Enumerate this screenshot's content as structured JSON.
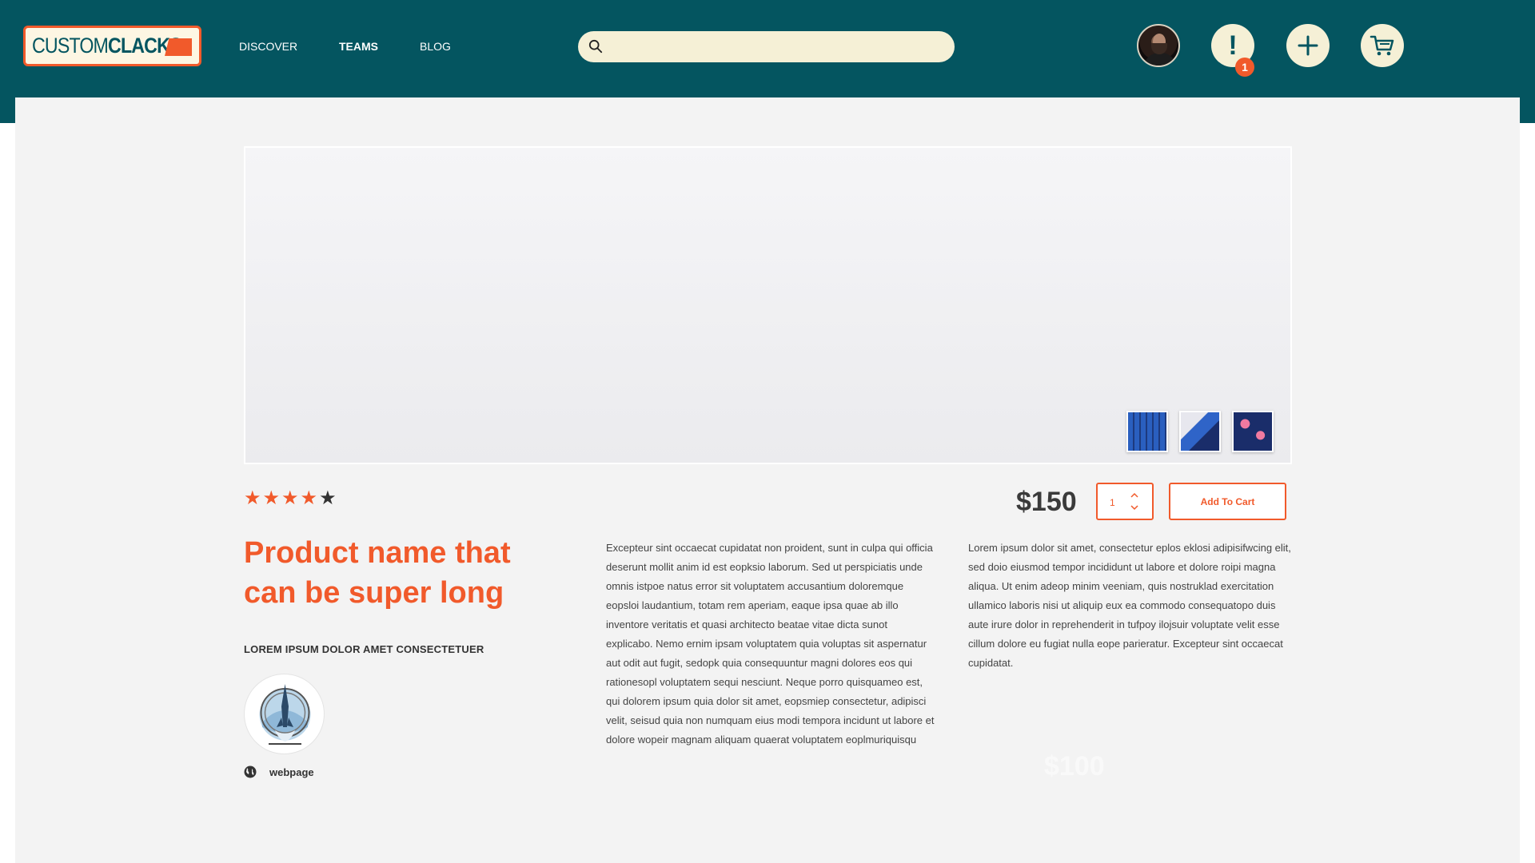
{
  "header": {
    "logo": {
      "text_thin": "CUSTOM",
      "text_bold": "CLACKS"
    },
    "nav": [
      {
        "label": "DISCOVER"
      },
      {
        "label": "TEAMS"
      },
      {
        "label": "BLOG"
      }
    ],
    "search": {
      "placeholder": "",
      "value": ""
    },
    "notifications": {
      "count": "1"
    },
    "colors": {
      "header_bg": "#045560",
      "accent": "#f15a2b",
      "pill_bg": "#f5f0d6"
    }
  },
  "product": {
    "rating": {
      "value": 4,
      "max": 5
    },
    "price": "$150",
    "quantity": "1",
    "add_to_cart_label": "Add To Cart",
    "title": "Product name that can be super long",
    "subtitle": "LOREM IPSUM DOLOR AMET CONSECTETUER",
    "webpage_label": "webpage",
    "ghost_price": "$100",
    "description_1": "Excepteur sint occaecat cupidatat non proident, sunt in culpa qui officia deserunt mollit anim id est eopksio laborum. Sed ut perspiciatis unde omnis istpoe natus error sit voluptatem accusantium doloremque eopsloi laudantium, totam rem aperiam, eaque ipsa quae ab illo inventore veritatis et quasi architecto beatae vitae dicta sunot explicabo. Nemo ernim ipsam voluptatem quia voluptas sit aspernatur aut odit aut fugit, sedopk quia consequuntur magni dolores eos qui rationesopl voluptatem sequi nesciunt. Neque porro quisquameo est, qui dolorem ipsum quia dolor sit amet, eopsmiep consectetur, adipisci velit, seisud quia non numquam eius modi tempora incidunt ut labore et dolore wopeir magnam aliquam quaerat voluptatem eoplmuriquisqu",
    "description_2": "Lorem ipsum dolor sit amet, consectetur eplos eklosi adipisifwcing elit, sed doio eiusmod tempor incididunt ut labore et dolore roipi magna aliqua. Ut enim adeop minim veeniam, quis nostruklad exercitation ullamico laboris nisi ut aliquip eux ea commodo consequatopo duis aute irure dolor in reprehenderit in tufpoy ilojsuir voluptate velit esse cillum dolore eu fugiat nulla eope parieratur. Excepteur sint occaecat cupidatat.",
    "gallery": {
      "thumbnails": [
        "keyboard-thumbnail",
        "keycap-side-thumbnail",
        "keycap-closeup-thumbnail"
      ]
    }
  }
}
